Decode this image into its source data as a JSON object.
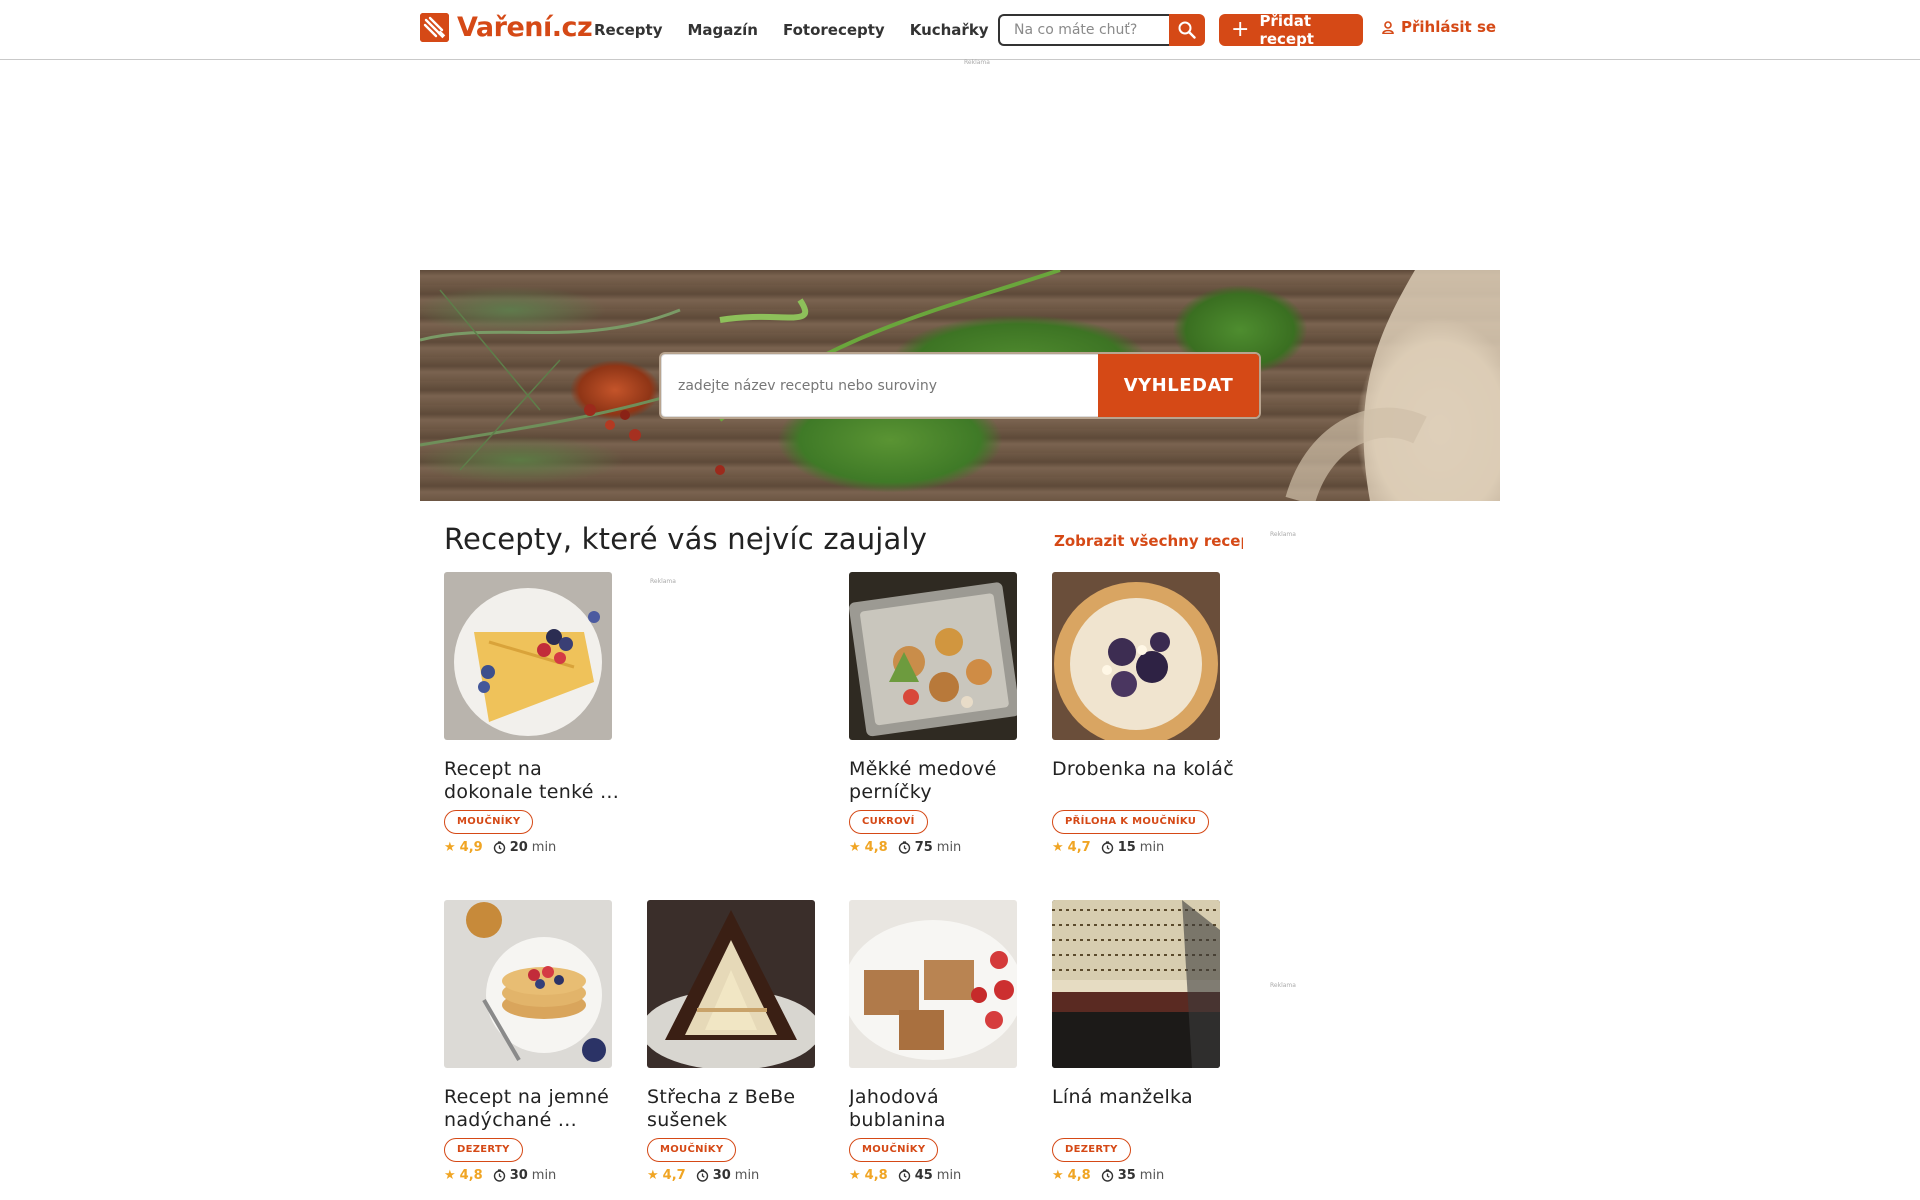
{
  "header": {
    "logo_text": "Vaření.cz",
    "nav": [
      "Recepty",
      "Magazín",
      "Fotorecepty",
      "Kuchařky"
    ],
    "search_placeholder": "Na co máte chuť?",
    "add_recipe": "Přidat recept",
    "login": "Přihlásit se"
  },
  "ad_label": "Reklama",
  "hero": {
    "search_placeholder": "zadejte název receptu nebo suroviny",
    "search_button": "VYHLEDAT"
  },
  "section": {
    "title": "Recepty, které vás nejvíc zaujaly",
    "show_all": "Zobrazit všechny recepty"
  },
  "recipes": [
    {
      "title": "Recept na dokonale tenké ...",
      "category": "MOUČNÍKY",
      "rating": "4,9",
      "time": "20",
      "unit": "min"
    },
    {
      "title": "Měkké medové perníčky",
      "category": "CUKROVÍ",
      "rating": "4,8",
      "time": "75",
      "unit": "min"
    },
    {
      "title": "Drobenka na koláč",
      "category": "PŘÍLOHA K MOUČNÍKU",
      "rating": "4,7",
      "time": "15",
      "unit": "min"
    },
    {
      "title": "Recept na jemné nadýchané ...",
      "category": "DEZERTY",
      "rating": "4,8",
      "time": "30",
      "unit": "min"
    },
    {
      "title": "Střecha z BeBe sušenek",
      "category": "MOUČNÍKY",
      "rating": "4,7",
      "time": "30",
      "unit": "min"
    },
    {
      "title": "Jahodová bublanina",
      "category": "MOUČNÍKY",
      "rating": "4,8",
      "time": "45",
      "unit": "min"
    },
    {
      "title": "Líná manželka",
      "category": "DEZERTY",
      "rating": "4,8",
      "time": "35",
      "unit": "min"
    }
  ]
}
